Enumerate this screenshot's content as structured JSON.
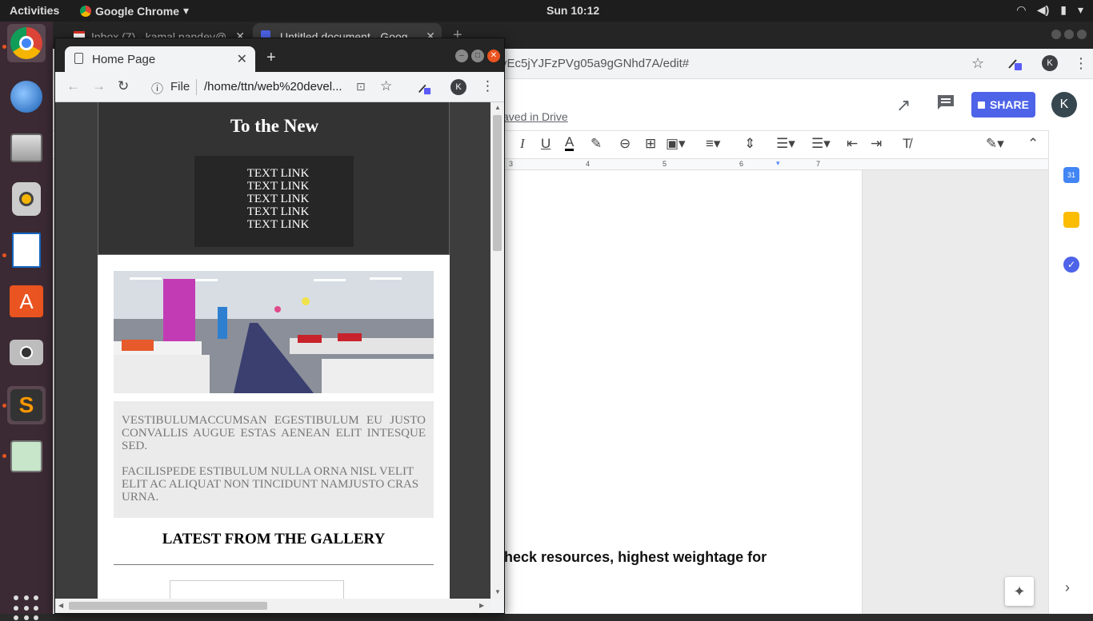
{
  "topbar": {
    "activities": "Activities",
    "app_name": "Google Chrome",
    "app_arrow": "▾",
    "clock": "Sun 10:12"
  },
  "dock": {
    "items": [
      "chrome-icon",
      "thunderbird-icon",
      "files-icon",
      "rhythmbox-icon",
      "writer-icon",
      "software-center-icon",
      "camera-icon",
      "sublime-text-icon",
      "image-viewer-icon"
    ]
  },
  "bg_window": {
    "tab1_title": "Inbox (7) - kamal.pandey@",
    "tab2_title": "Untitled document - Goog",
    "url": "vEc5jYJFzPVg05a9gGNhd7A/edit#",
    "saved_text": "aved in Drive",
    "share_label": "SHARE",
    "avatar_letter": "K",
    "doc_text": "heck resources, highest weightage for",
    "ruler_marks": [
      "3",
      "4",
      "5",
      "6",
      "7"
    ],
    "accent": "#4d63e8"
  },
  "fg_window": {
    "tab_title": "Home Page",
    "file_label": "File",
    "url": "/home/ttn/web%20devel...",
    "avatar_letter": "K"
  },
  "page": {
    "title": "To the New",
    "nav_links": [
      "TEXT LINK",
      "TEXT LINK",
      "TEXT LINK",
      "TEXT LINK",
      "TEXT LINK"
    ],
    "intro_p1": "VESTIBULUMACCUMSAN EGESTIBULUM EU JUSTO CONVALLIS AUGUE ESTAS AENEAN ELIT INTESQUE SED.",
    "intro_p2": "FACILISPEDE ESTIBULUM NULLA ORNA NISL VELIT ELIT AC ALIQUAT NON TINCIDUNT NAMJUSTO CRAS URNA.",
    "gallery_heading": "LATEST FROM THE GALLERY"
  }
}
